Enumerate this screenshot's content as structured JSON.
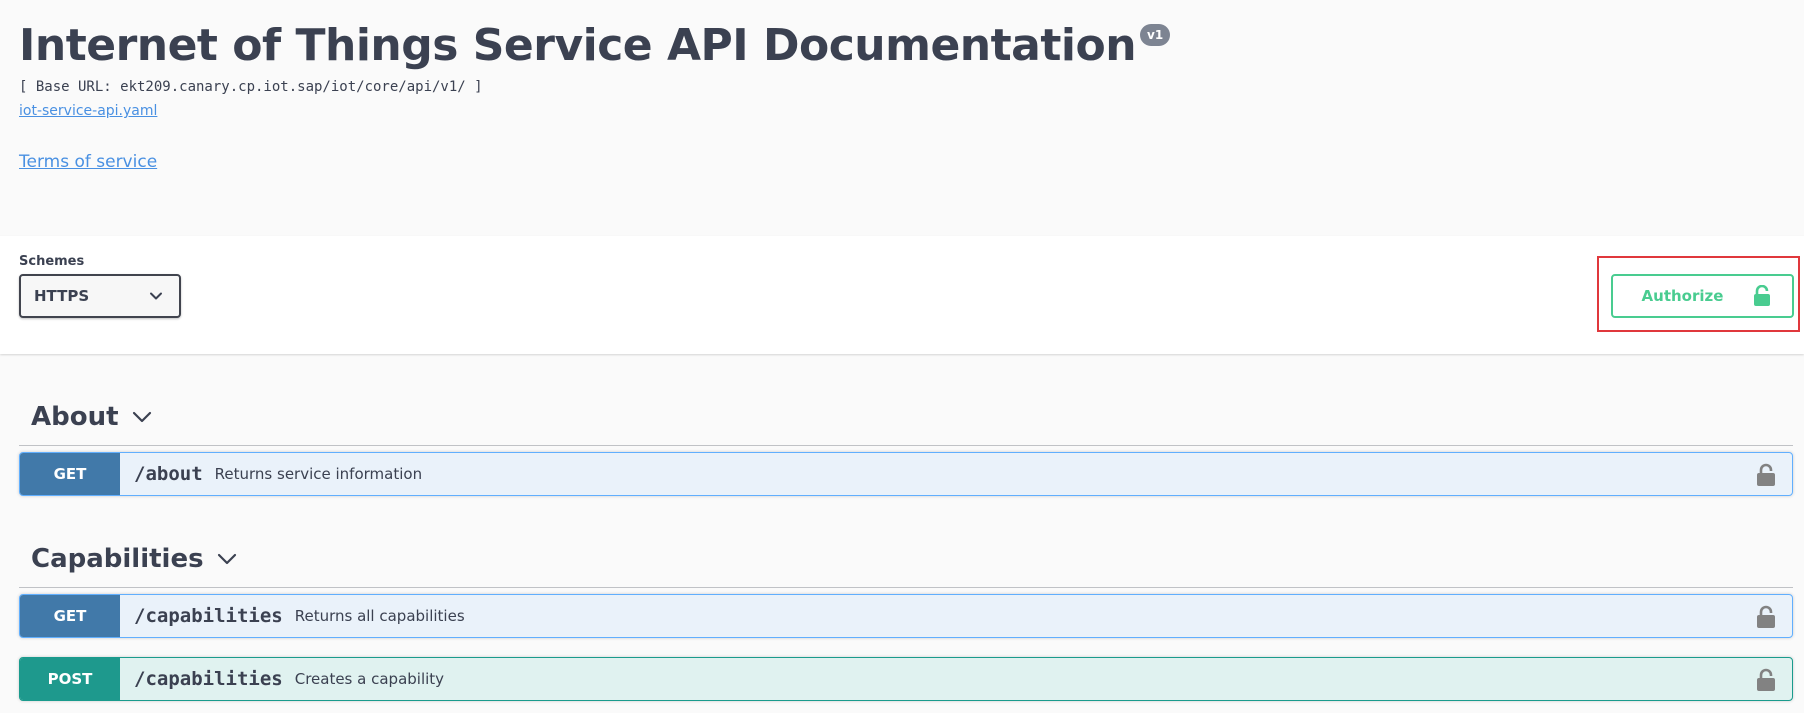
{
  "info": {
    "title": "Internet of Things Service API Documentation",
    "version": "v1",
    "base_url": "[ Base URL: ekt209.canary.cp.iot.sap/iot/core/api/v1/ ]",
    "spec_link": "iot-service-api.yaml",
    "terms_link": "Terms of service"
  },
  "schemes": {
    "label": "Schemes",
    "selected": "HTTPS"
  },
  "authorize": {
    "label": "Authorize",
    "icon": "unlocked-padlock-icon",
    "color": "#49cc90",
    "highlight_color": "#e0383c"
  },
  "tags": [
    {
      "name": "About",
      "operations": [
        {
          "method": "GET",
          "path": "/about",
          "summary": "Returns service information"
        }
      ]
    },
    {
      "name": "Capabilities",
      "operations": [
        {
          "method": "GET",
          "path": "/capabilities",
          "summary": "Returns all capabilities"
        },
        {
          "method": "POST",
          "path": "/capabilities",
          "summary": "Creates a capability"
        }
      ]
    }
  ],
  "colors": {
    "get": "#4179a9",
    "post": "#1e998d",
    "link": "#4990e2",
    "text": "#3b4151"
  }
}
